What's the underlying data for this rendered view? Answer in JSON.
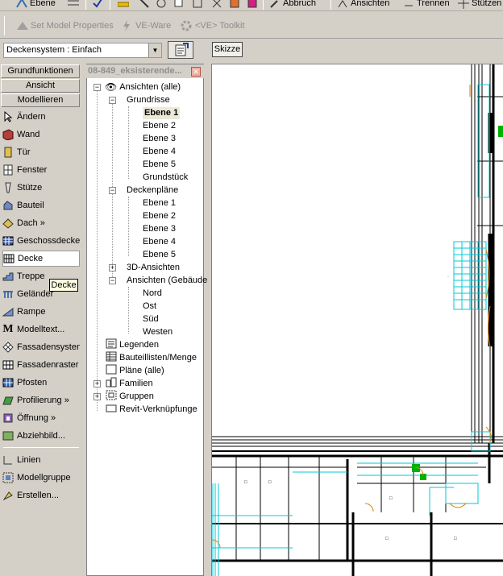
{
  "toolbar_top": {
    "items": [
      "Ebene",
      "Abbruch",
      "Ansichten",
      "Trennen",
      "Stützen"
    ]
  },
  "toolbar_second": {
    "set_model_properties": "Set Model Properties",
    "ve_ware": "VE-Ware",
    "ve_toolkit": "<VE> Toolkit"
  },
  "type_selector": {
    "value": "Deckensystem : Einfach"
  },
  "sketch_button": "Skizze",
  "design_bar": {
    "tabs": [
      "Grundfunktionen",
      "Ansicht",
      "Modellieren"
    ],
    "items": [
      {
        "label": "Ändern",
        "icon": "arrow-icon"
      },
      {
        "label": "Wand",
        "icon": "wall-icon"
      },
      {
        "label": "Tür",
        "icon": "door-icon"
      },
      {
        "label": "Fenster",
        "icon": "window-icon"
      },
      {
        "label": "Stütze",
        "icon": "column-icon"
      },
      {
        "label": "Bauteil",
        "icon": "component-icon"
      },
      {
        "label": "Dach »",
        "icon": "roof-icon"
      },
      {
        "label": "Geschossdecke",
        "icon": "floor-icon"
      },
      {
        "label": "Decke",
        "icon": "ceiling-icon",
        "active": true
      },
      {
        "label": "Treppe",
        "icon": "stairs-icon"
      },
      {
        "label": "Geländer",
        "icon": "railing-icon"
      },
      {
        "label": "Rampe",
        "icon": "ramp-icon"
      },
      {
        "label": "Modelltext...",
        "icon": "model-text-icon"
      },
      {
        "label": "Fassadensystem",
        "icon": "curtain-system-icon"
      },
      {
        "label": "Fassadenraster",
        "icon": "curtain-grid-icon"
      },
      {
        "label": "Pfosten",
        "icon": "mullion-icon"
      },
      {
        "label": "Profilierung »",
        "icon": "profile-icon"
      },
      {
        "label": "Öffnung »",
        "icon": "opening-icon"
      },
      {
        "label": "Abziehbild...",
        "icon": "decal-icon"
      },
      {
        "label": "Linien",
        "icon": "lines-icon"
      },
      {
        "label": "Modellgruppe",
        "icon": "model-group-icon"
      },
      {
        "label": "Erstellen...",
        "icon": "create-icon"
      }
    ],
    "tooltip": "Decke"
  },
  "project_browser": {
    "title": "08-849_eksisterende...",
    "root": "Ansichten (alle)",
    "grundrisse_label": "Grundrisse",
    "grundrisse": [
      "Ebene 1",
      "Ebene 2",
      "Ebene 3",
      "Ebene 4",
      "Ebene 5",
      "Grundstück"
    ],
    "deckenplaene_label": "Deckenpläne",
    "deckenplaene": [
      "Ebene 1",
      "Ebene 2",
      "Ebene 3",
      "Ebene 4",
      "Ebene 5"
    ],
    "ansichten_3d": "3D-Ansichten",
    "ansichten_gebaeude": "Ansichten (Gebäude",
    "gebaeude": [
      "Nord",
      "Ost",
      "Süd",
      "Westen"
    ],
    "others": [
      "Legenden",
      "Bauteillisten/Menge",
      "Pläne (alle)",
      "Familien",
      "Gruppen",
      "Revit-Verknüpfunge"
    ]
  },
  "colors": {
    "cyan": "#00c8d8",
    "green": "#00b000",
    "orange": "#e08000"
  }
}
